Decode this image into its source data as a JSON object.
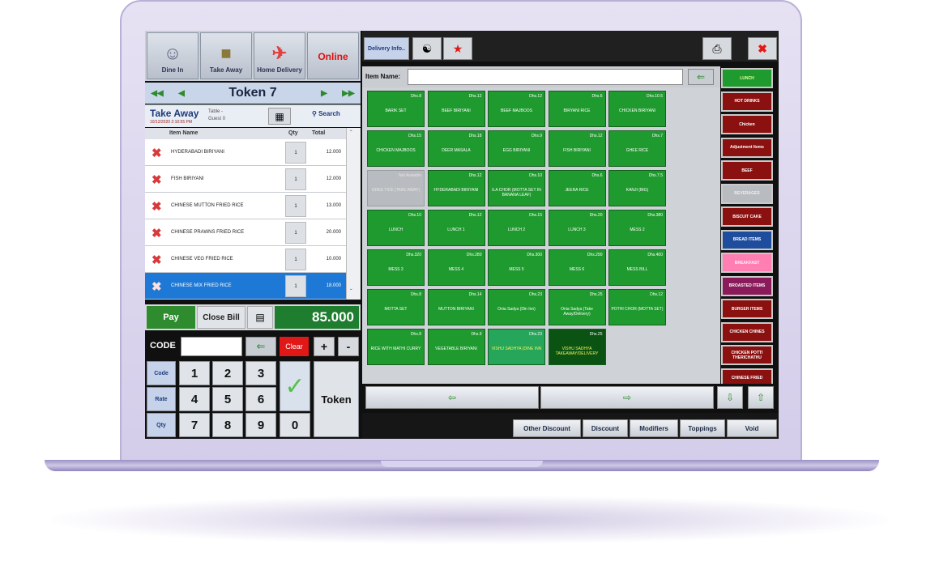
{
  "colors": {
    "accent_green": "#1f9a2e",
    "selected_blue": "#1e79d6",
    "online_red": "#e01010",
    "category_red": "#8b1010"
  },
  "modes": [
    {
      "label": "Dine In",
      "icon": "waiter-icon"
    },
    {
      "label": "Take Away",
      "icon": "takeaway-bag-icon"
    },
    {
      "label": "Home Delivery",
      "icon": "scooter-icon"
    },
    {
      "label": "Online",
      "icon": ""
    }
  ],
  "token": {
    "label": "Token 7"
  },
  "order": {
    "type": "Take Away",
    "datetime": "10/12/2020 2:10:55 PM",
    "table_label": "Table",
    "table_value": "-",
    "guest_label": "Guest",
    "guest_value": "0",
    "search_label": "Search"
  },
  "table": {
    "headers": {
      "item": "Item Name",
      "qty": "Qty",
      "total": "Total"
    },
    "rows": [
      {
        "name": "HYDERABADI BIRIYANI",
        "qty": "1",
        "total": "12.000",
        "selected": false
      },
      {
        "name": "FISH BIRIYANI",
        "qty": "1",
        "total": "12.000",
        "selected": false
      },
      {
        "name": "CHINESE MUTTON FRIED RICE",
        "qty": "1",
        "total": "13.000",
        "selected": false
      },
      {
        "name": "CHINESE PRAWNS FRIED RICE",
        "qty": "1",
        "total": "20.000",
        "selected": false
      },
      {
        "name": "CHINESE VEG FRIED RICE",
        "qty": "1",
        "total": "10.000",
        "selected": false
      },
      {
        "name": "CHINESE MIX FRIED RICE",
        "qty": "1",
        "total": "18.000",
        "selected": true
      }
    ]
  },
  "actions": {
    "pay": "Pay",
    "close_bill": "Close Bill",
    "total": "85.000"
  },
  "code": {
    "label": "CODE",
    "value": "",
    "clear": "Clear",
    "plus": "+",
    "minus": "-"
  },
  "keypad": {
    "keys": [
      "1",
      "2",
      "3",
      "4",
      "5",
      "6",
      "7",
      "8",
      "9",
      "0"
    ],
    "functions": [
      "Code",
      "Rate",
      "Qty"
    ],
    "ok": "✓",
    "token": "Token"
  },
  "toolbar": {
    "delivery_info": "Delivery Info..",
    "item_name_label": "Item Name:",
    "item_name_value": ""
  },
  "items": [
    {
      "name": "BARIK SET",
      "price": "Dhs.8",
      "state": "normal"
    },
    {
      "name": "BEEF BIRIYANI",
      "price": "Dhs.12",
      "state": "normal"
    },
    {
      "name": "BEEF MAJBOOS",
      "price": "Dhs.12",
      "state": "normal"
    },
    {
      "name": "BIRYANI RICE",
      "price": "Dhs.6",
      "state": "normal"
    },
    {
      "name": "CHICKEN BIRIYANI",
      "price": "Dhs.10.5",
      "state": "normal"
    },
    {
      "name": "CHICKEN MAJBOOS",
      "price": "Dhs.15",
      "state": "normal"
    },
    {
      "name": "DEER MASALA",
      "price": "Dhs.18",
      "state": "normal"
    },
    {
      "name": "EGG BIRIYANI",
      "price": "Dhs.9",
      "state": "normal"
    },
    {
      "name": "FISH BIRIYANI",
      "price": "Dhs.12",
      "state": "normal"
    },
    {
      "name": "GHEE RICE",
      "price": "Dhs.7",
      "state": "normal"
    },
    {
      "name": "GHEE TICE (TAKE AWAY)",
      "price": "Not Avaiable",
      "state": "na"
    },
    {
      "name": "HYDERABADI BIRIYANI",
      "price": "Dhs.12",
      "state": "normal"
    },
    {
      "name": "ILA CHOR (MOTTA SET IN BANANA LEAF)",
      "price": "Dhs.10",
      "state": "normal"
    },
    {
      "name": "JEERA RICE",
      "price": "Dhs.6",
      "state": "normal"
    },
    {
      "name": "KANJI (BIG)",
      "price": "Dhs.7.5",
      "state": "normal"
    },
    {
      "name": "LUNCH",
      "price": "Dhs.10",
      "state": "normal"
    },
    {
      "name": "LUNCH 1",
      "price": "Dhs.12",
      "state": "normal"
    },
    {
      "name": "LUNCH 2",
      "price": "Dhs.15",
      "state": "normal"
    },
    {
      "name": "LUNCH 3",
      "price": "Dhs.20",
      "state": "normal"
    },
    {
      "name": "MESS 2",
      "price": "Dhs.380",
      "state": "normal"
    },
    {
      "name": "MESS 3",
      "price": "Dhs.320",
      "state": "normal"
    },
    {
      "name": "MESS 4",
      "price": "Dhs.280",
      "state": "normal"
    },
    {
      "name": "MESS 5",
      "price": "Dhs.300",
      "state": "normal"
    },
    {
      "name": "MESS 6",
      "price": "Dhs.290",
      "state": "normal"
    },
    {
      "name": "MESS BILL",
      "price": "Dhs.400",
      "state": "normal"
    },
    {
      "name": "MOTTA SET",
      "price": "Dhs.8",
      "state": "normal"
    },
    {
      "name": "MUTTON BIRIYANI",
      "price": "Dhs.14",
      "state": "normal"
    },
    {
      "name": "Onia Sadya (Din Inn)",
      "price": "Dhs.23",
      "state": "normal"
    },
    {
      "name": "Onia Sadya (Take Away/Delivery)",
      "price": "Dhs.25",
      "state": "normal"
    },
    {
      "name": "POTHI CHOR (MOTTA SET)",
      "price": "Dhs.12",
      "state": "normal"
    },
    {
      "name": "RICE WITH MATHI CURRY",
      "price": "Dhs.8",
      "state": "normal"
    },
    {
      "name": "VEGETABLE BIRIYANI",
      "price": "Dhs.9",
      "state": "normal"
    },
    {
      "name": "VISHU SADHYA (DINE INN",
      "price": "Dhs.23",
      "state": "ltg"
    },
    {
      "name": "VISHU SADHYA TAKEAWAY/DELIVERY",
      "price": "Dhs.25",
      "state": "dk"
    }
  ],
  "categories": [
    {
      "name": "LUNCH",
      "style": "grn"
    },
    {
      "name": "HOT DRINKS",
      "style": "red"
    },
    {
      "name": "Chicken",
      "style": "red"
    },
    {
      "name": "Adjustment Items",
      "style": "red"
    },
    {
      "name": "BEEF",
      "style": "red"
    },
    {
      "name": "BEVERAGES",
      "style": "gry"
    },
    {
      "name": "BISCUIT CAKE",
      "style": "red"
    },
    {
      "name": "BREAD ITEMS",
      "style": "blu"
    },
    {
      "name": "BREAKFAST",
      "style": "pnk"
    },
    {
      "name": "BROASTED ITEMS",
      "style": "pur"
    },
    {
      "name": "BURGER ITEMS",
      "style": "red"
    },
    {
      "name": "CHICKEN CHINES",
      "style": "red"
    },
    {
      "name": "CHICKEN POTTI THERICHATHU",
      "style": "red"
    },
    {
      "name": "CHINESE FRIED",
      "style": "red"
    }
  ],
  "pager": {
    "prev": "⇦",
    "next": "⇨",
    "down": "⇩",
    "up": "⇧"
  },
  "bottom_buttons": [
    "Other Discount",
    "Discount",
    "Modifiers",
    "Toppings",
    "Void"
  ]
}
